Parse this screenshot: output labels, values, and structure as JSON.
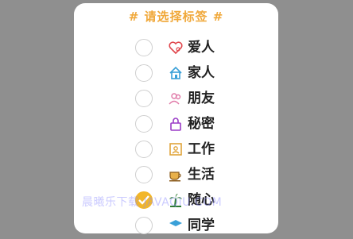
{
  "dialog": {
    "title": "# 请选择标签 #",
    "tags": [
      {
        "label": "爱人",
        "icon": "heart-person-icon",
        "selected": false
      },
      {
        "label": "家人",
        "icon": "house-icon",
        "selected": false
      },
      {
        "label": "朋友",
        "icon": "friends-icon",
        "selected": false
      },
      {
        "label": "秘密",
        "icon": "lock-icon",
        "selected": false
      },
      {
        "label": "工作",
        "icon": "badge-icon",
        "selected": false
      },
      {
        "label": "生活",
        "icon": "coffee-cup-icon",
        "selected": false
      },
      {
        "label": "随心",
        "icon": "palm-tree-icon",
        "selected": true
      },
      {
        "label": "同学",
        "icon": "graduate-icon",
        "selected": false
      }
    ]
  },
  "watermark": "晨曦乐下载 JAVAQIU.COM",
  "colors": {
    "accent": "#f0a83a",
    "checked": "#f2b628",
    "overlay": "#8f8f8f"
  }
}
